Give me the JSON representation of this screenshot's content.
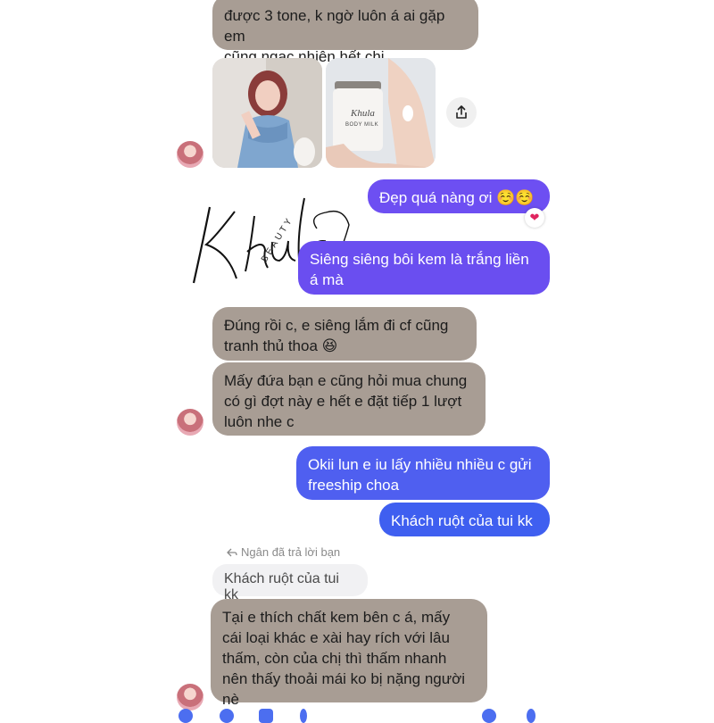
{
  "colors": {
    "incoming_bubble": "#a89d94",
    "outgoing_purple": "#6d4ff2",
    "outgoing_blue": "#3f5ff0",
    "reply_quote_bg": "#f1f1f3"
  },
  "messages": [
    {
      "id": "m1",
      "side": "incoming",
      "lines": [
        "được 3 tone, k ngờ luôn á ai gặp em",
        "cũng ngạc nhiên hết chị"
      ]
    },
    {
      "id": "m2",
      "side": "incoming",
      "type": "photos",
      "photos": [
        "girl-in-blue-dress-photo",
        "body-milk-jar-photo"
      ]
    },
    {
      "id": "m3",
      "side": "outgoing",
      "lines": [
        "Đẹp quá nàng ơi ☺️☺️"
      ],
      "reaction": "heart-icon"
    },
    {
      "id": "m4",
      "side": "outgoing",
      "lines": [
        "Siêng siêng bôi kem là trắng liền",
        "á mà"
      ]
    },
    {
      "id": "m5",
      "side": "incoming",
      "lines": [
        "Đúng rồi c, e siêng lắm đi cf cũng",
        "tranh thủ thoa 😆"
      ]
    },
    {
      "id": "m6",
      "side": "incoming",
      "lines": [
        "Mấy đứa bạn e cũng hỏi mua chung",
        "có gì đợt này e hết e đặt tiếp 1 lượt",
        "luôn nhe c"
      ]
    },
    {
      "id": "m7",
      "side": "outgoing",
      "lines": [
        "Okii lun e iu lấy nhiều nhiều c gửi",
        "freeship choa"
      ]
    },
    {
      "id": "m8",
      "side": "outgoing",
      "lines": [
        "Khách ruột của tui kk"
      ]
    },
    {
      "id": "m9",
      "side": "incoming",
      "lines": [
        "Tại e thích chất kem bên c á, mấy",
        "cái loại khác e xài hay rích với lâu",
        "thấm, còn của chị thì thấm nhanh",
        "nên thấy thoải mái ko bị nặng người",
        "nè"
      ]
    }
  ],
  "reply_context": {
    "label": "Ngân đã trả lời bạn",
    "quoted": "Khách ruột của tui kk"
  },
  "watermark": {
    "logo": "K'hula",
    "sub": "BEAUTY"
  },
  "product_label": {
    "brand": "Khula",
    "name": "BODY MILK"
  }
}
